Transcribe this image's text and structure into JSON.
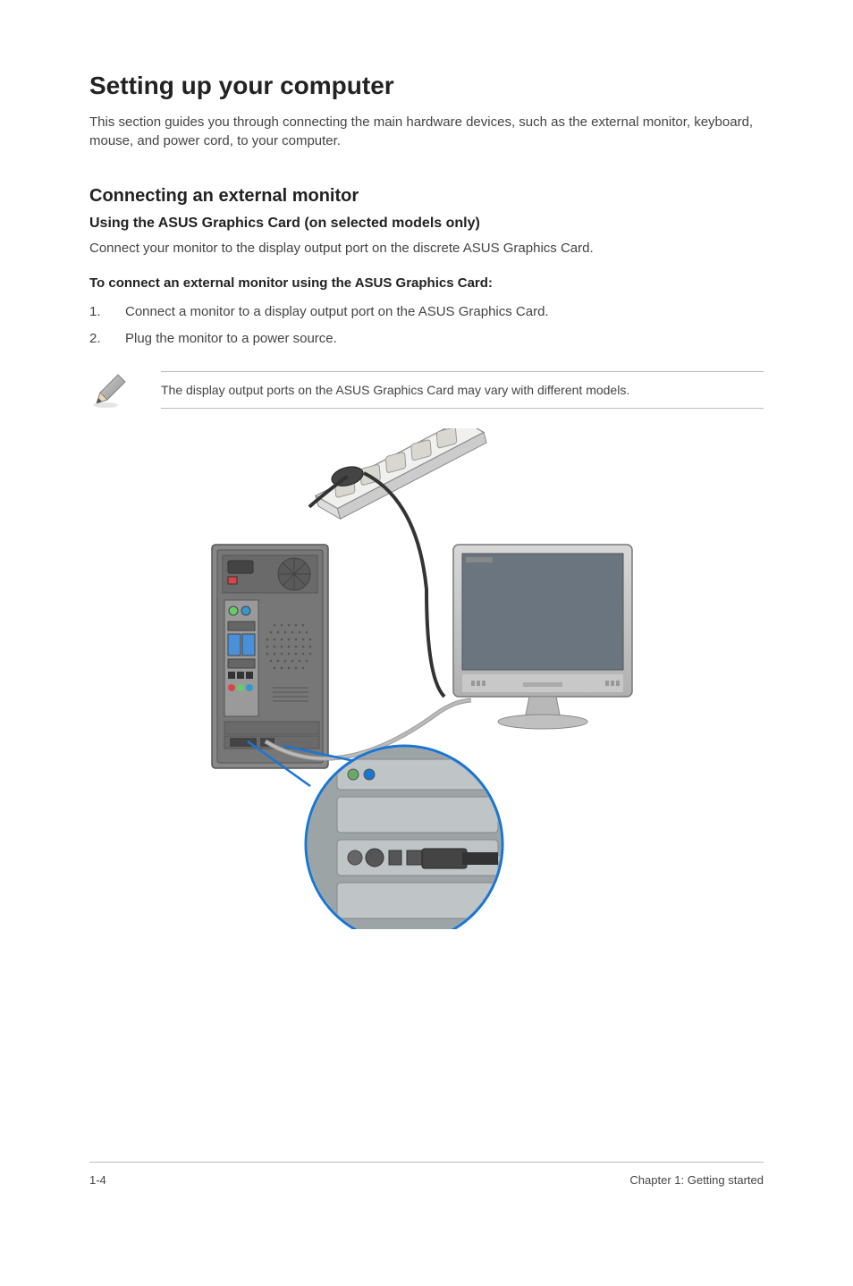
{
  "title": "Setting up your computer",
  "intro": "This section guides you through connecting the main hardware devices, such as the external monitor, keyboard, mouse, and power cord, to your computer.",
  "section": {
    "heading": "Connecting an external monitor",
    "sub_heading": "Using the ASUS Graphics Card (on selected models only)",
    "body": "Connect your monitor to the display output port on the discrete ASUS Graphics Card.",
    "instruction_heading": "To connect an external monitor using the ASUS Graphics Card:",
    "steps": [
      {
        "num": "1.",
        "text": "Connect a monitor to a display output port on the ASUS Graphics Card."
      },
      {
        "num": "2.",
        "text": "Plug the monitor to a power source."
      }
    ],
    "note": "The display output ports on the ASUS Graphics Card may vary with different models."
  },
  "footer": {
    "page_num": "1-4",
    "chapter": "Chapter 1: Getting started"
  }
}
